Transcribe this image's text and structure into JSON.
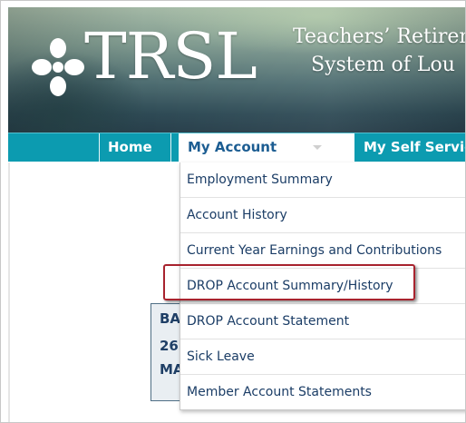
{
  "header": {
    "logo_text": "TRSL",
    "org_name_line1": "Teachers’ Retirem",
    "org_name_line2": "System of Lou"
  },
  "nav": {
    "home": "Home",
    "my_account": "My Account",
    "my_self_service": "My Self Servic"
  },
  "dropdown": {
    "items": [
      {
        "label": "Employment Summary"
      },
      {
        "label": "Account History"
      },
      {
        "label": "Current Year Earnings and Contributions"
      },
      {
        "label": "DROP Account Summary/History",
        "highlighted": true
      },
      {
        "label": "DROP Account Statement"
      },
      {
        "label": "Sick Leave"
      },
      {
        "label": "Member Account Statements"
      }
    ]
  },
  "background_panel": {
    "line1": "BA",
    "line2": "26",
    "line3": "MA"
  },
  "colors": {
    "nav_bg": "#0c9bb0",
    "menu_text": "#1b3d66",
    "highlight_border": "#a8232e"
  }
}
